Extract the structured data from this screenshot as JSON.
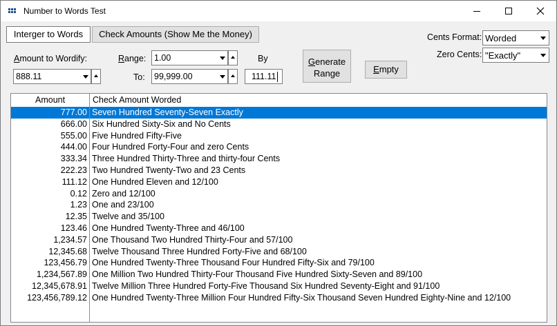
{
  "window": {
    "title": "Number to Words Test"
  },
  "tabs": [
    {
      "label": "Interger to Words"
    },
    {
      "label": "Check Amounts (Show Me the Money)"
    }
  ],
  "amount": {
    "label_prefix": "",
    "label_underline": "A",
    "label_rest": "mount to Wordify:",
    "value": "888.11"
  },
  "range": {
    "label_underline": "R",
    "label_rest": "ange:",
    "from_value": "1.00",
    "to_label": "To:",
    "to_value": "99,999.00",
    "by_label": "By",
    "by_value": "111.11"
  },
  "generate_button": {
    "line1_underline": "G",
    "line1_rest": "enerate",
    "line2": "Range"
  },
  "empty_button": {
    "label_underline": "E",
    "label_rest": "mpty"
  },
  "cents_format": {
    "label": "Cents Format:",
    "value": "Worded"
  },
  "zero_cents": {
    "label": "Zero Cents:",
    "value": "\"Exactly\""
  },
  "table": {
    "headers": {
      "amount": "Amount",
      "words": "Check Amount Worded"
    },
    "rows": [
      {
        "amount": "777.00",
        "words": "Seven Hundred Seventy-Seven Exactly",
        "selected": true
      },
      {
        "amount": "666.00",
        "words": "Six Hundred Sixty-Six and No Cents"
      },
      {
        "amount": "555.00",
        "words": "Five Hundred Fifty-Five"
      },
      {
        "amount": "444.00",
        "words": "Four Hundred Forty-Four and zero Cents"
      },
      {
        "amount": "333.34",
        "words": "Three Hundred Thirty-Three and thirty-four Cents"
      },
      {
        "amount": "222.23",
        "words": "Two Hundred Twenty-Two and 23 Cents"
      },
      {
        "amount": "111.12",
        "words": "One Hundred Eleven and 12/100"
      },
      {
        "amount": "0.12",
        "words": "Zero and 12/100"
      },
      {
        "amount": "1.23",
        "words": "One and 23/100"
      },
      {
        "amount": "12.35",
        "words": "Twelve and 35/100"
      },
      {
        "amount": "123.46",
        "words": "One Hundred Twenty-Three and 46/100"
      },
      {
        "amount": "1,234.57",
        "words": "One Thousand Two Hundred Thirty-Four and 57/100"
      },
      {
        "amount": "12,345.68",
        "words": "Twelve Thousand Three Hundred Forty-Five and 68/100"
      },
      {
        "amount": "123,456.79",
        "words": "One Hundred Twenty-Three Thousand Four Hundred Fifty-Six and 79/100"
      },
      {
        "amount": "1,234,567.89",
        "words": "One Million Two Hundred Thirty-Four Thousand Five Hundred Sixty-Seven and 89/100"
      },
      {
        "amount": "12,345,678.91",
        "words": "Twelve Million Three Hundred Forty-Five Thousand Six Hundred Seventy-Eight and 91/100"
      },
      {
        "amount": "123,456,789.12",
        "words": "One Hundred Twenty-Three Million Four Hundred Fifty-Six Thousand Seven Hundred Eighty-Nine and 12/100"
      }
    ]
  },
  "colors": {
    "selection": "#0078d7",
    "window_bg": "#f0f0f0"
  },
  "icons": [
    "app-grid-icon",
    "minimize-icon",
    "maximize-icon",
    "close-icon",
    "dropdown-arrow-icon",
    "spin-up-icon"
  ]
}
